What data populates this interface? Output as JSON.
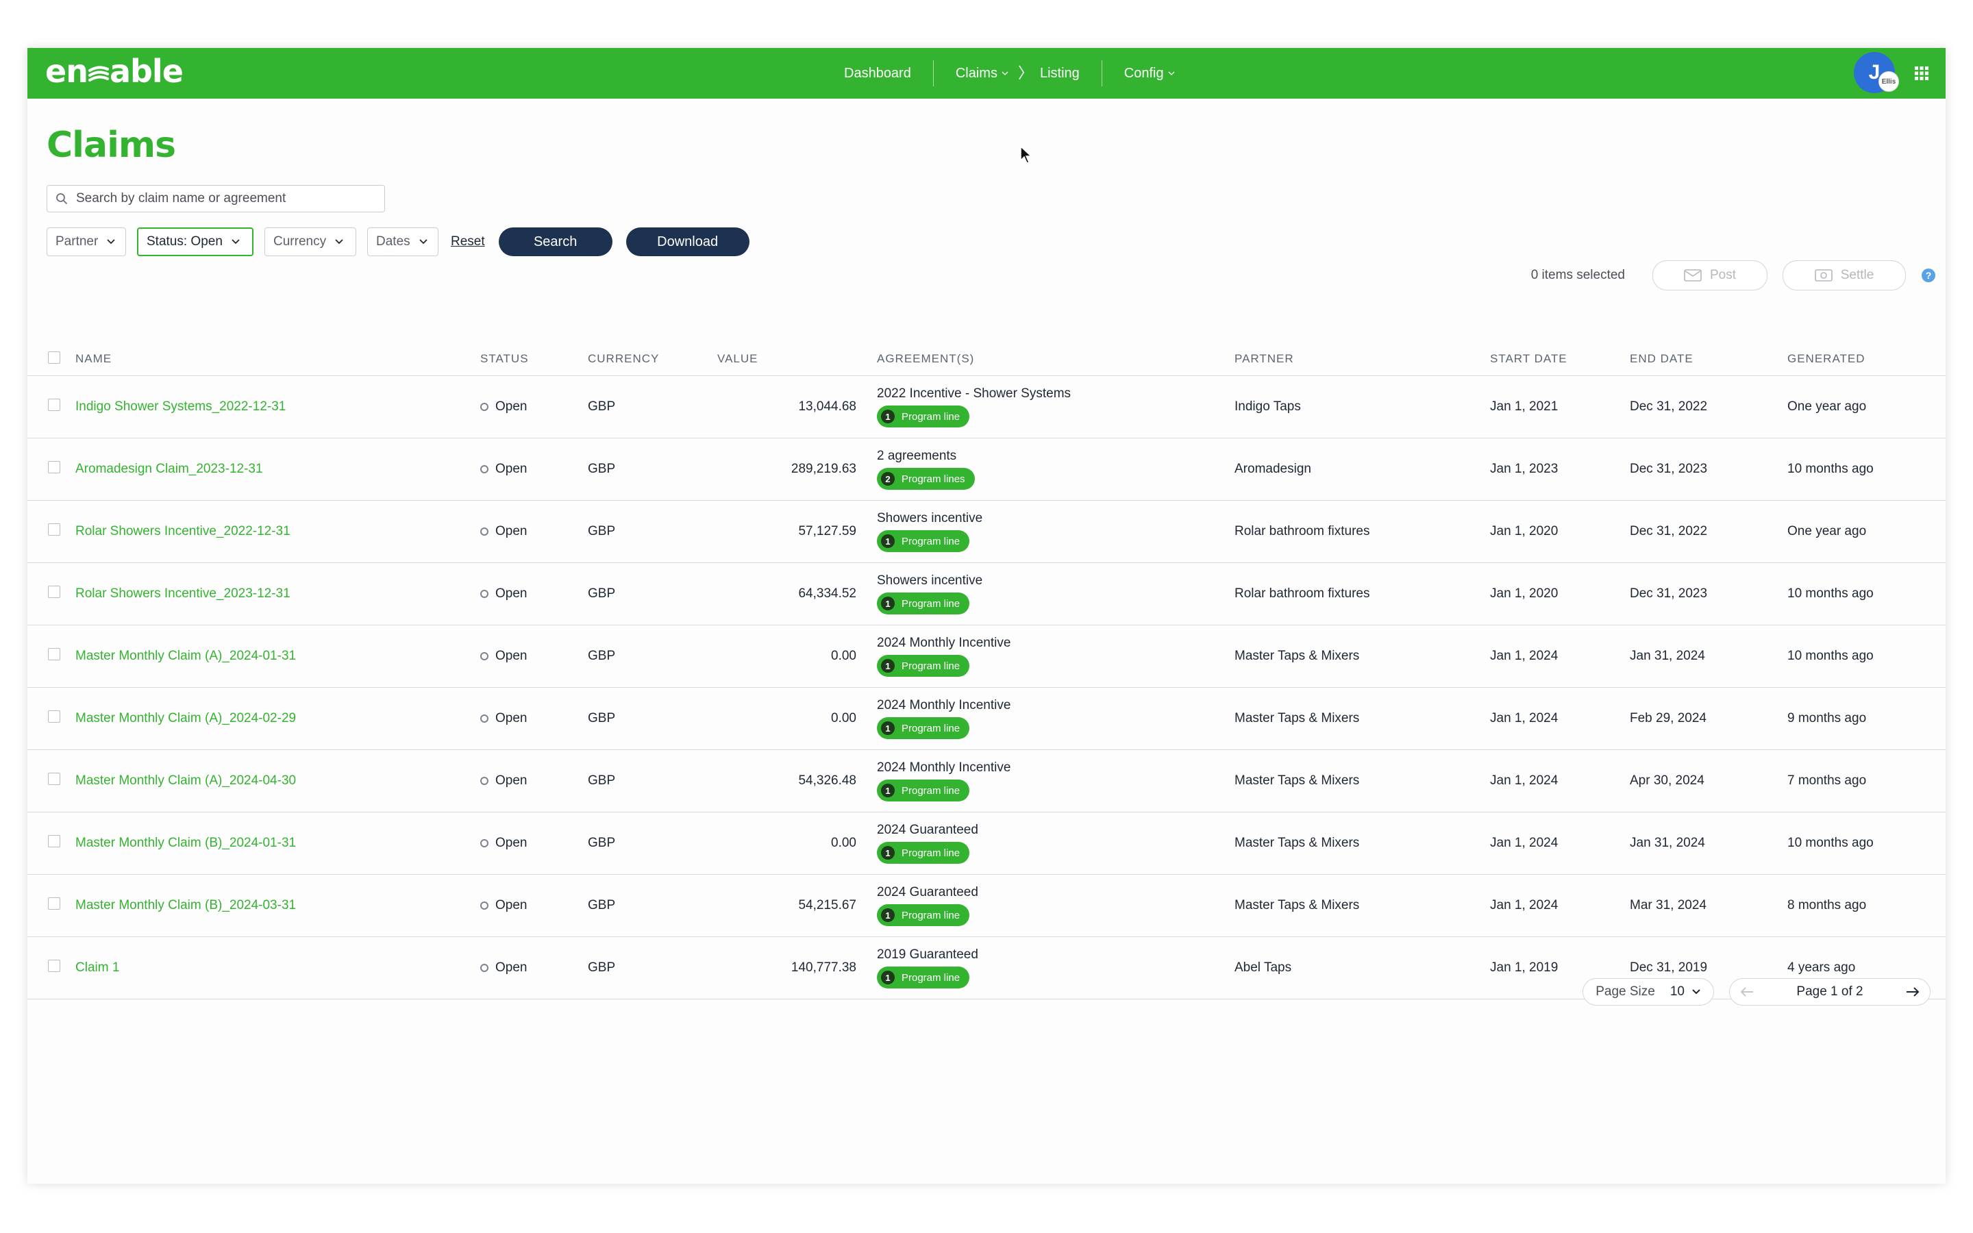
{
  "brand": {
    "logo": "enable",
    "accent": "#33b32f",
    "dark_button": "#1d3150"
  },
  "nav": {
    "dashboard": "Dashboard",
    "claims": "Claims",
    "listing": "Listing",
    "config": "Config"
  },
  "user": {
    "initial": "J",
    "badge": "Ellis"
  },
  "page": {
    "title": "Claims",
    "search_placeholder": "Search by claim name or agreement"
  },
  "filters": {
    "partner": "Partner",
    "status": "Status: Open",
    "currency": "Currency",
    "dates": "Dates",
    "reset": "Reset",
    "search": "Search",
    "download": "Download"
  },
  "selection": {
    "items_selected": "0 items selected",
    "post": "Post",
    "settle": "Settle"
  },
  "table": {
    "headers": {
      "name": "NAME",
      "status": "STATUS",
      "currency": "CURRENCY",
      "value": "VALUE",
      "agreements": "AGREEMENT(S)",
      "partner": "PARTNER",
      "start_date": "START DATE",
      "end_date": "END DATE",
      "generated": "GENERATED"
    },
    "rows": [
      {
        "name": "Indigo Shower Systems_2022-12-31",
        "status": "Open",
        "currency": "GBP",
        "value": "13,044.68",
        "agreement": "2022 Incentive - Shower Systems",
        "pill_count": "1",
        "pill_label": "Program line",
        "partner": "Indigo Taps",
        "start": "Jan 1, 2021",
        "end": "Dec 31, 2022",
        "generated": "One year ago"
      },
      {
        "name": "Aromadesign Claim_2023-12-31",
        "status": "Open",
        "currency": "GBP",
        "value": "289,219.63",
        "agreement": "2 agreements",
        "pill_count": "2",
        "pill_label": "Program lines",
        "partner": "Aromadesign",
        "start": "Jan 1, 2023",
        "end": "Dec 31, 2023",
        "generated": "10 months ago"
      },
      {
        "name": "Rolar Showers Incentive_2022-12-31",
        "status": "Open",
        "currency": "GBP",
        "value": "57,127.59",
        "agreement": "Showers incentive",
        "pill_count": "1",
        "pill_label": "Program line",
        "partner": "Rolar bathroom fixtures",
        "start": "Jan 1, 2020",
        "end": "Dec 31, 2022",
        "generated": "One year ago"
      },
      {
        "name": "Rolar Showers Incentive_2023-12-31",
        "status": "Open",
        "currency": "GBP",
        "value": "64,334.52",
        "agreement": "Showers incentive",
        "pill_count": "1",
        "pill_label": "Program line",
        "partner": "Rolar bathroom fixtures",
        "start": "Jan 1, 2020",
        "end": "Dec 31, 2023",
        "generated": "10 months ago"
      },
      {
        "name": "Master Monthly Claim (A)_2024-01-31",
        "status": "Open",
        "currency": "GBP",
        "value": "0.00",
        "agreement": "2024 Monthly Incentive",
        "pill_count": "1",
        "pill_label": "Program line",
        "partner": "Master Taps & Mixers",
        "start": "Jan 1, 2024",
        "end": "Jan 31, 2024",
        "generated": "10 months ago"
      },
      {
        "name": "Master Monthly Claim (A)_2024-02-29",
        "status": "Open",
        "currency": "GBP",
        "value": "0.00",
        "agreement": "2024 Monthly Incentive",
        "pill_count": "1",
        "pill_label": "Program line",
        "partner": "Master Taps & Mixers",
        "start": "Jan 1, 2024",
        "end": "Feb 29, 2024",
        "generated": "9 months ago"
      },
      {
        "name": "Master Monthly Claim (A)_2024-04-30",
        "status": "Open",
        "currency": "GBP",
        "value": "54,326.48",
        "agreement": "2024 Monthly Incentive",
        "pill_count": "1",
        "pill_label": "Program line",
        "partner": "Master Taps & Mixers",
        "start": "Jan 1, 2024",
        "end": "Apr 30, 2024",
        "generated": "7 months ago"
      },
      {
        "name": "Master Monthly Claim (B)_2024-01-31",
        "status": "Open",
        "currency": "GBP",
        "value": "0.00",
        "agreement": "2024 Guaranteed",
        "pill_count": "1",
        "pill_label": "Program line",
        "partner": "Master Taps & Mixers",
        "start": "Jan 1, 2024",
        "end": "Jan 31, 2024",
        "generated": "10 months ago"
      },
      {
        "name": "Master Monthly Claim (B)_2024-03-31",
        "status": "Open",
        "currency": "GBP",
        "value": "54,215.67",
        "agreement": "2024 Guaranteed",
        "pill_count": "1",
        "pill_label": "Program line",
        "partner": "Master Taps & Mixers",
        "start": "Jan 1, 2024",
        "end": "Mar 31, 2024",
        "generated": "8 months ago"
      },
      {
        "name": "Claim 1",
        "status": "Open",
        "currency": "GBP",
        "value": "140,777.38",
        "agreement": "2019 Guaranteed",
        "pill_count": "1",
        "pill_label": "Program line",
        "partner": "Abel Taps",
        "start": "Jan 1, 2019",
        "end": "Dec 31, 2019",
        "generated": "4 years ago"
      }
    ]
  },
  "pagination": {
    "page_size_label": "Page Size",
    "page_size": "10",
    "page_label": "Page 1 of 2"
  }
}
